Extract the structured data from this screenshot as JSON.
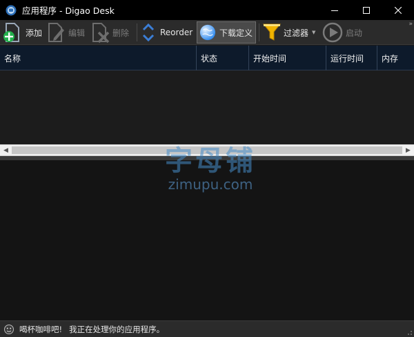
{
  "window": {
    "title": "应用程序 - Digao Desk"
  },
  "toolbar": {
    "add_label": "添加",
    "edit_label": "编辑",
    "delete_label": "删除",
    "reorder_label": "Reorder",
    "download_def_label": "下载定义",
    "filter_label": "过滤器",
    "start_label": "启动",
    "overflow": "»"
  },
  "list": {
    "columns": [
      "名称",
      "状态",
      "开始时间",
      "运行时间",
      "内存"
    ]
  },
  "watermark": {
    "cn": "字母铺",
    "en": "zimupu.com"
  },
  "status": {
    "greeting": "喝杯咖啡吧!",
    "message": "我正在处理你的应用程序。"
  },
  "colors": {
    "add_green": "#22b14c",
    "accent_blue": "#2d89ef",
    "filter_yellow": "#f0b400",
    "disabled_gray": "#777777",
    "header_bg": "#0d1a2b"
  }
}
